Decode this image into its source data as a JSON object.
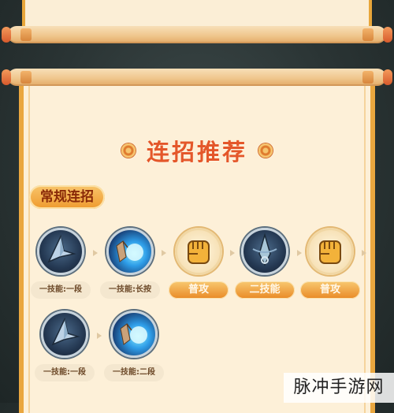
{
  "header": {
    "title": "连招推荐"
  },
  "section": {
    "tag": "常规连招"
  },
  "combo_row1": [
    {
      "label": "一技能:一段",
      "icon": "shuriken-icon",
      "style": "dim"
    },
    {
      "label": "一技能:长按",
      "icon": "energy-palm-icon",
      "style": "dim"
    },
    {
      "label": "普攻",
      "icon": "fist-icon",
      "style": "hl"
    },
    {
      "label": "二技能",
      "icon": "kunai-icon",
      "style": "hl"
    },
    {
      "label": "普攻",
      "icon": "fist-icon",
      "style": "hl"
    }
  ],
  "combo_row2": [
    {
      "label": "一技能:一段",
      "icon": "shuriken-icon",
      "style": "dim"
    },
    {
      "label": "一技能:二段",
      "icon": "energy-palm-icon",
      "style": "dim"
    }
  ],
  "watermark": {
    "text": "脉冲手游网"
  },
  "colors": {
    "title": "#e4572a",
    "tag_bg": "#ef9a2e",
    "label_highlight": "#e98a26",
    "scroll_border": "#eaa73f",
    "paper": "#fdf0d8"
  }
}
